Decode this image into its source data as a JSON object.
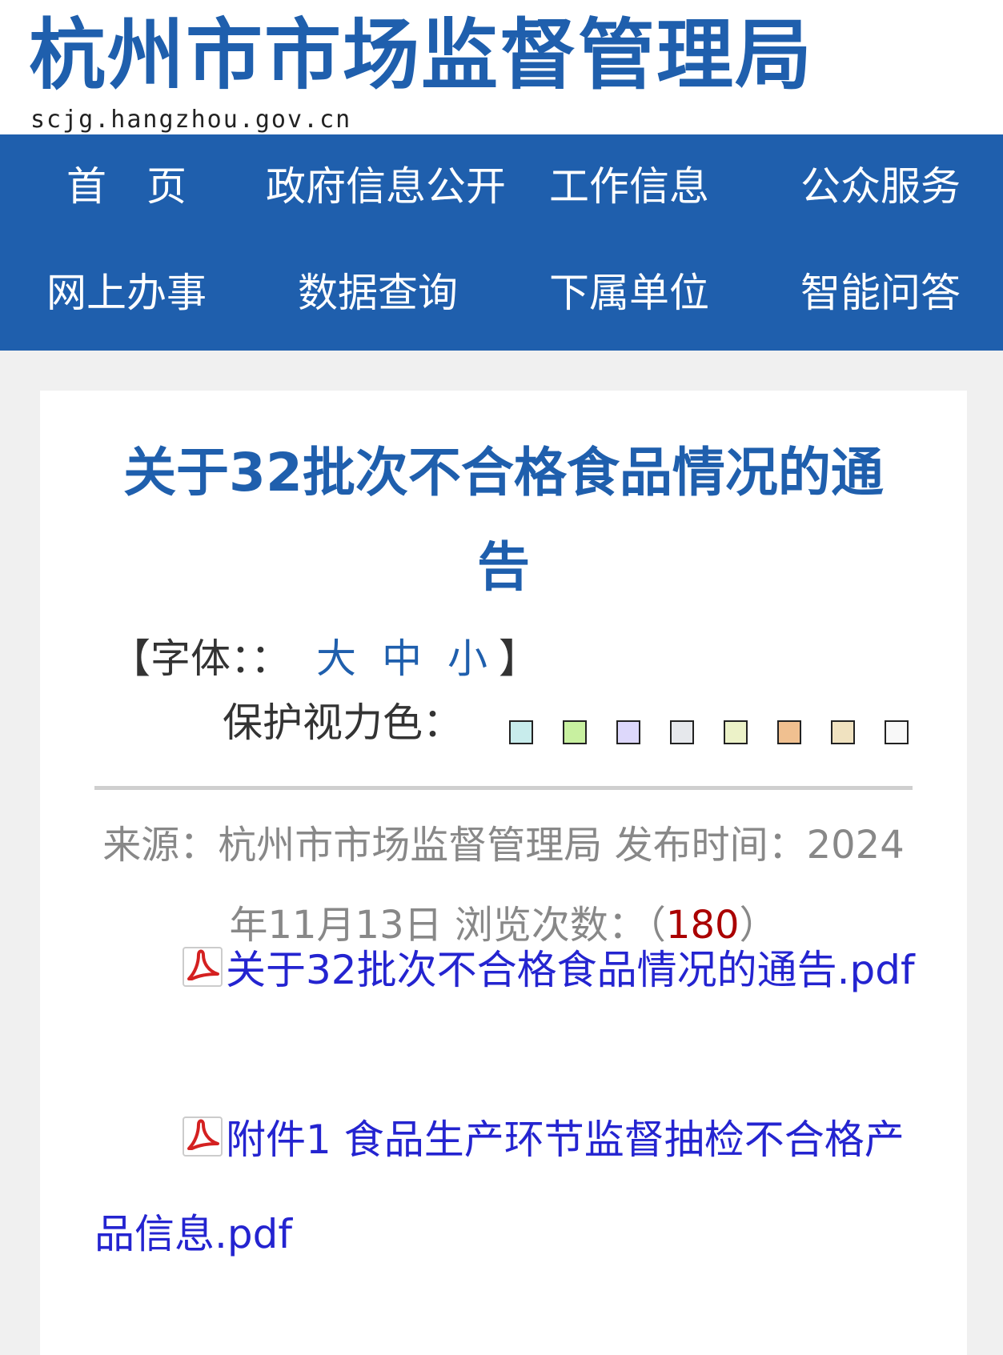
{
  "header": {
    "site_title": "杭州市市场监督管理局",
    "site_domain": "scjg.hangzhou.gov.cn"
  },
  "nav": {
    "items": [
      "首　页",
      "政府信息公开",
      "工作信息",
      "公众服务",
      "网上办事",
      "数据查询",
      "下属单位",
      "智能问答"
    ]
  },
  "article": {
    "title": "关于32批次不合格食品情况的通告",
    "font_size": {
      "label": "【字体：：",
      "large": "大",
      "medium": "中",
      "small": "小",
      "close": "】"
    },
    "eye_care": {
      "label": "保护视力色：",
      "colors": [
        "#c8ecec",
        "#c8f0a0",
        "#ddd8fb",
        "#e6e8ec",
        "#ecf2c8",
        "#f0c090",
        "#f0e2c0",
        "#f8f8f8"
      ]
    },
    "meta": {
      "source_label": "来源：",
      "source": "杭州市市场监督管理局",
      "published_label": "发布时间：",
      "published": "2024年11月13日",
      "views_label": "浏览次数：（",
      "views": "180",
      "views_close": "）"
    },
    "attachments": [
      {
        "icon": "pdf-icon",
        "name": "关于32批次不合格食品情况的通告.pdf"
      },
      {
        "icon": "pdf-icon",
        "name": "附件1 食品生产环节监督抽检不合格产品信息.pdf"
      }
    ]
  },
  "colors": {
    "brand_blue": "#1f5fad",
    "link_blue": "#2424d0",
    "count_red": "#aa0000"
  }
}
